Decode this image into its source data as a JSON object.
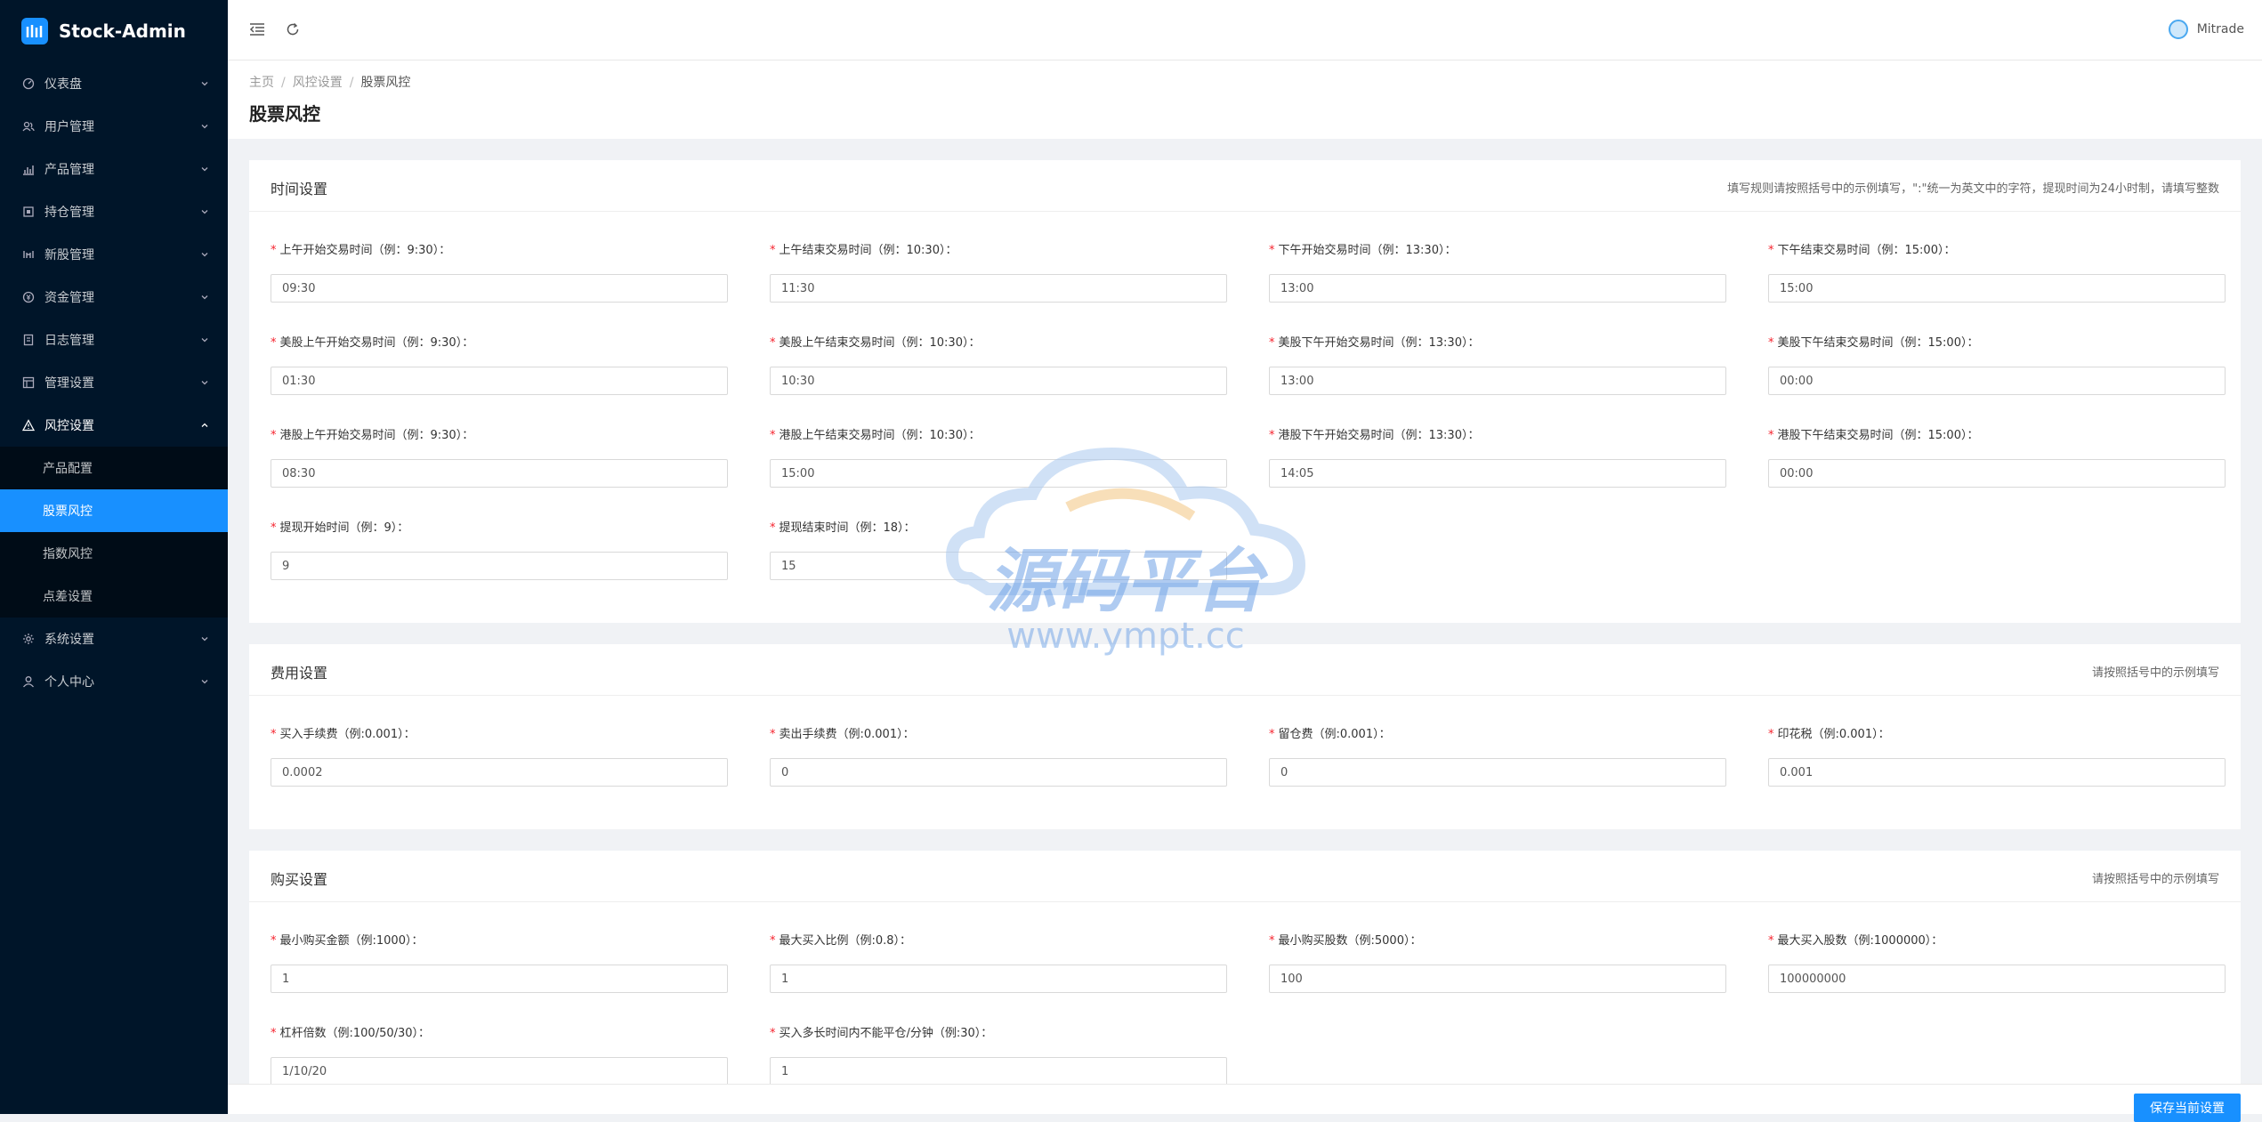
{
  "app": {
    "title": "Stock-Admin"
  },
  "sidebar": {
    "items": [
      {
        "label": "仪表盘",
        "icon": "dashboard-icon"
      },
      {
        "label": "用户管理",
        "icon": "users-icon"
      },
      {
        "label": "产品管理",
        "icon": "chart-icon"
      },
      {
        "label": "持仓管理",
        "icon": "position-icon"
      },
      {
        "label": "新股管理",
        "icon": "ipo-icon"
      },
      {
        "label": "资金管理",
        "icon": "money-icon"
      },
      {
        "label": "日志管理",
        "icon": "log-icon"
      },
      {
        "label": "管理设置",
        "icon": "admin-settings-icon"
      },
      {
        "label": "风控设置",
        "icon": "warning-icon"
      }
    ],
    "submenu": [
      "产品配置",
      "股票风控",
      "指数风控",
      "点差设置"
    ],
    "bottom_items": [
      {
        "label": "系统设置",
        "icon": "gear-icon"
      },
      {
        "label": "个人中心",
        "icon": "user-icon"
      }
    ]
  },
  "header": {
    "username": "Mitrade"
  },
  "breadcrumb": {
    "home": "主页",
    "parent": "风控设置",
    "current": "股票风控",
    "separator": "/"
  },
  "page": {
    "title": "股票风控"
  },
  "sections": {
    "time": {
      "title": "时间设置",
      "hint": "填写规则请按照括号中的示例填写，\":\"统一为英文中的字符，提现时间为24小时制，请填写整数",
      "fields": [
        {
          "label": "上午开始交易时间（例：9:30）：",
          "value": "09:30"
        },
        {
          "label": "上午结束交易时间（例：10:30）：",
          "value": "11:30"
        },
        {
          "label": "下午开始交易时间（例：13:30）：",
          "value": "13:00"
        },
        {
          "label": "下午结束交易时间（例：15:00）：",
          "value": "15:00"
        },
        {
          "label": "美股上午开始交易时间（例：9:30）：",
          "value": "01:30"
        },
        {
          "label": "美股上午结束交易时间（例：10:30）：",
          "value": "10:30"
        },
        {
          "label": "美股下午开始交易时间（例：13:30）：",
          "value": "13:00"
        },
        {
          "label": "美股下午结束交易时间（例：15:00）：",
          "value": "00:00"
        },
        {
          "label": "港股上午开始交易时间（例：9:30）：",
          "value": "08:30"
        },
        {
          "label": "港股上午结束交易时间（例：10:30）：",
          "value": "15:00"
        },
        {
          "label": "港股下午开始交易时间（例：13:30）：",
          "value": "14:05"
        },
        {
          "label": "港股下午结束交易时间（例：15:00）：",
          "value": "00:00"
        },
        {
          "label": "提现开始时间（例：9）：",
          "value": "9"
        },
        {
          "label": "提现结束时间（例：18）：",
          "value": "15"
        }
      ]
    },
    "fee": {
      "title": "费用设置",
      "hint": "请按照括号中的示例填写",
      "fields": [
        {
          "label": "买入手续费（例:0.001）：",
          "value": "0.0002"
        },
        {
          "label": "卖出手续费（例:0.001）：",
          "value": "0"
        },
        {
          "label": "留仓费（例:0.001）：",
          "value": "0"
        },
        {
          "label": "印花税（例:0.001）：",
          "value": "0.001"
        }
      ]
    },
    "buy": {
      "title": "购买设置",
      "hint": "请按照括号中的示例填写",
      "fields": [
        {
          "label": "最小购买金额（例:1000）：",
          "value": "1"
        },
        {
          "label": "最大买入比例（例:0.8）：",
          "value": "1"
        },
        {
          "label": "最小购买股数（例:5000）：",
          "value": "100"
        },
        {
          "label": "最大买入股数（例:1000000）：",
          "value": "100000000"
        },
        {
          "label": "杠杆倍数（例:100/50/30）：",
          "value": "1/10/20"
        },
        {
          "label": "买入多长时间内不能平仓/分钟（例:30）：",
          "value": "1"
        }
      ]
    }
  },
  "footer": {
    "save_label": "保存当前设置"
  },
  "watermark": {
    "text": "源码平台",
    "url": "www.ympt.cc"
  },
  "colors": {
    "sidebar_bg": "#001529",
    "primary": "#1890ff",
    "required": "#f5222d"
  }
}
